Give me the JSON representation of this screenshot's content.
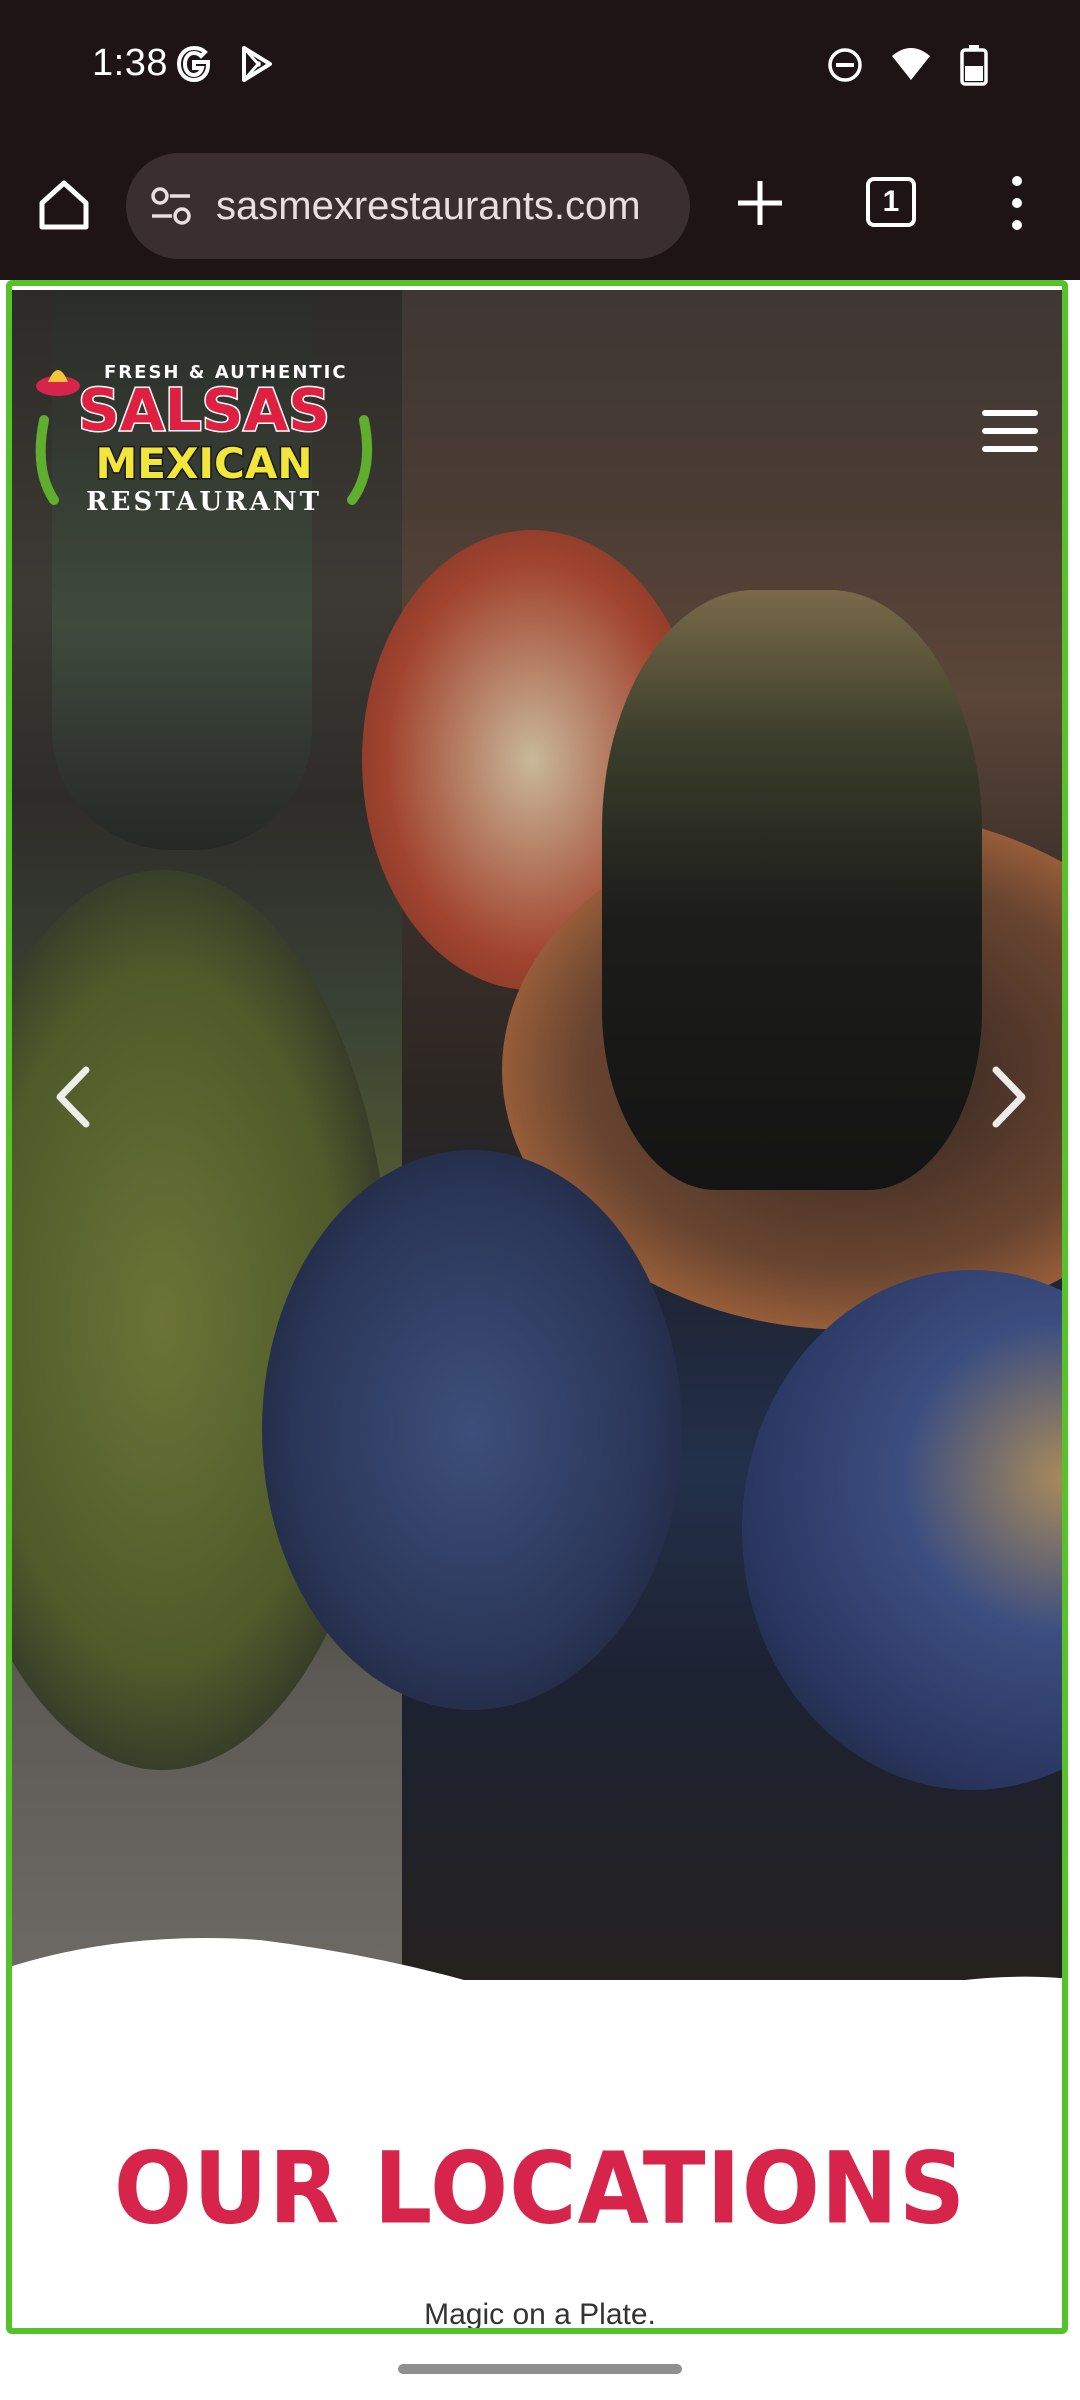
{
  "status_bar": {
    "time": "1:38",
    "left_icons": [
      "google-icon",
      "play-store-icon"
    ],
    "right_icons": [
      "do-not-disturb-icon",
      "wifi-icon",
      "battery-icon"
    ]
  },
  "browser": {
    "url": "sasmexrestaurants.com",
    "tab_count": "1",
    "buttons": [
      "home-icon",
      "site-settings-icon",
      "new-tab-icon",
      "tab-switcher",
      "more-menu-icon"
    ]
  },
  "hero": {
    "logo": {
      "top_line": "FRESH & AUTHENTIC",
      "brand": "SALSAS",
      "middle": "MEXICAN",
      "bottom": "RESTAURANT"
    },
    "controls": [
      "chevron-left-icon",
      "chevron-right-icon",
      "hamburger-menu-icon"
    ]
  },
  "locations": {
    "title": "OUR LOCATIONS",
    "subtitle": "Magic on a Plate."
  },
  "colors": {
    "title_red": "#d6244a",
    "frame_green": "#55c22a",
    "chrome_dark": "#1e1416"
  }
}
